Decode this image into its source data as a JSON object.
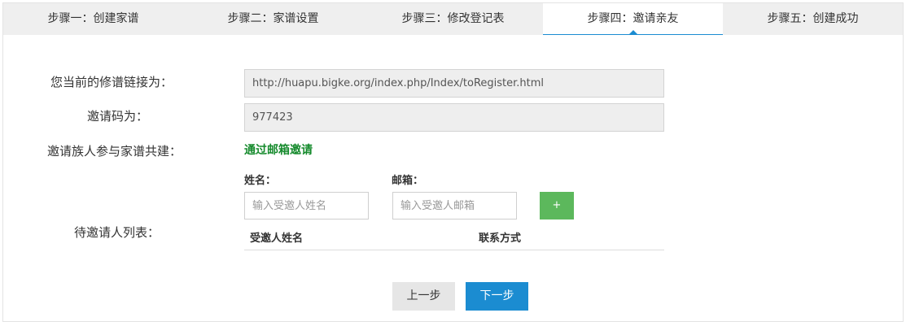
{
  "steps": [
    {
      "label": "步骤一：创建家谱"
    },
    {
      "label": "步骤二：家谱设置"
    },
    {
      "label": "步骤三：修改登记表"
    },
    {
      "label": "步骤四：邀请亲友"
    },
    {
      "label": "步骤五：创建成功"
    }
  ],
  "active_step_index": 3,
  "form": {
    "link_label": "您当前的修谱链接为：",
    "link_value": "http://huapu.bigke.org/index.php/Index/toRegister.html",
    "code_label": "邀请码为：",
    "code_value": "977423",
    "invite_label": "邀请族人参与家谱共建：",
    "invite_by_email": "通过邮箱邀请",
    "name_label": "姓名：",
    "name_placeholder": "输入受邀人姓名",
    "email_label": "邮箱：",
    "email_placeholder": "输入受邀人邮箱",
    "add_button": "+",
    "list_label": "待邀请人列表：",
    "list_columns": [
      "受邀人姓名",
      "联系方式"
    ]
  },
  "actions": {
    "prev": "上一步",
    "next": "下一步"
  },
  "colors": {
    "accent_blue": "#1b8cd1",
    "add_green": "#5cb85c",
    "link_green": "#158a2c"
  }
}
